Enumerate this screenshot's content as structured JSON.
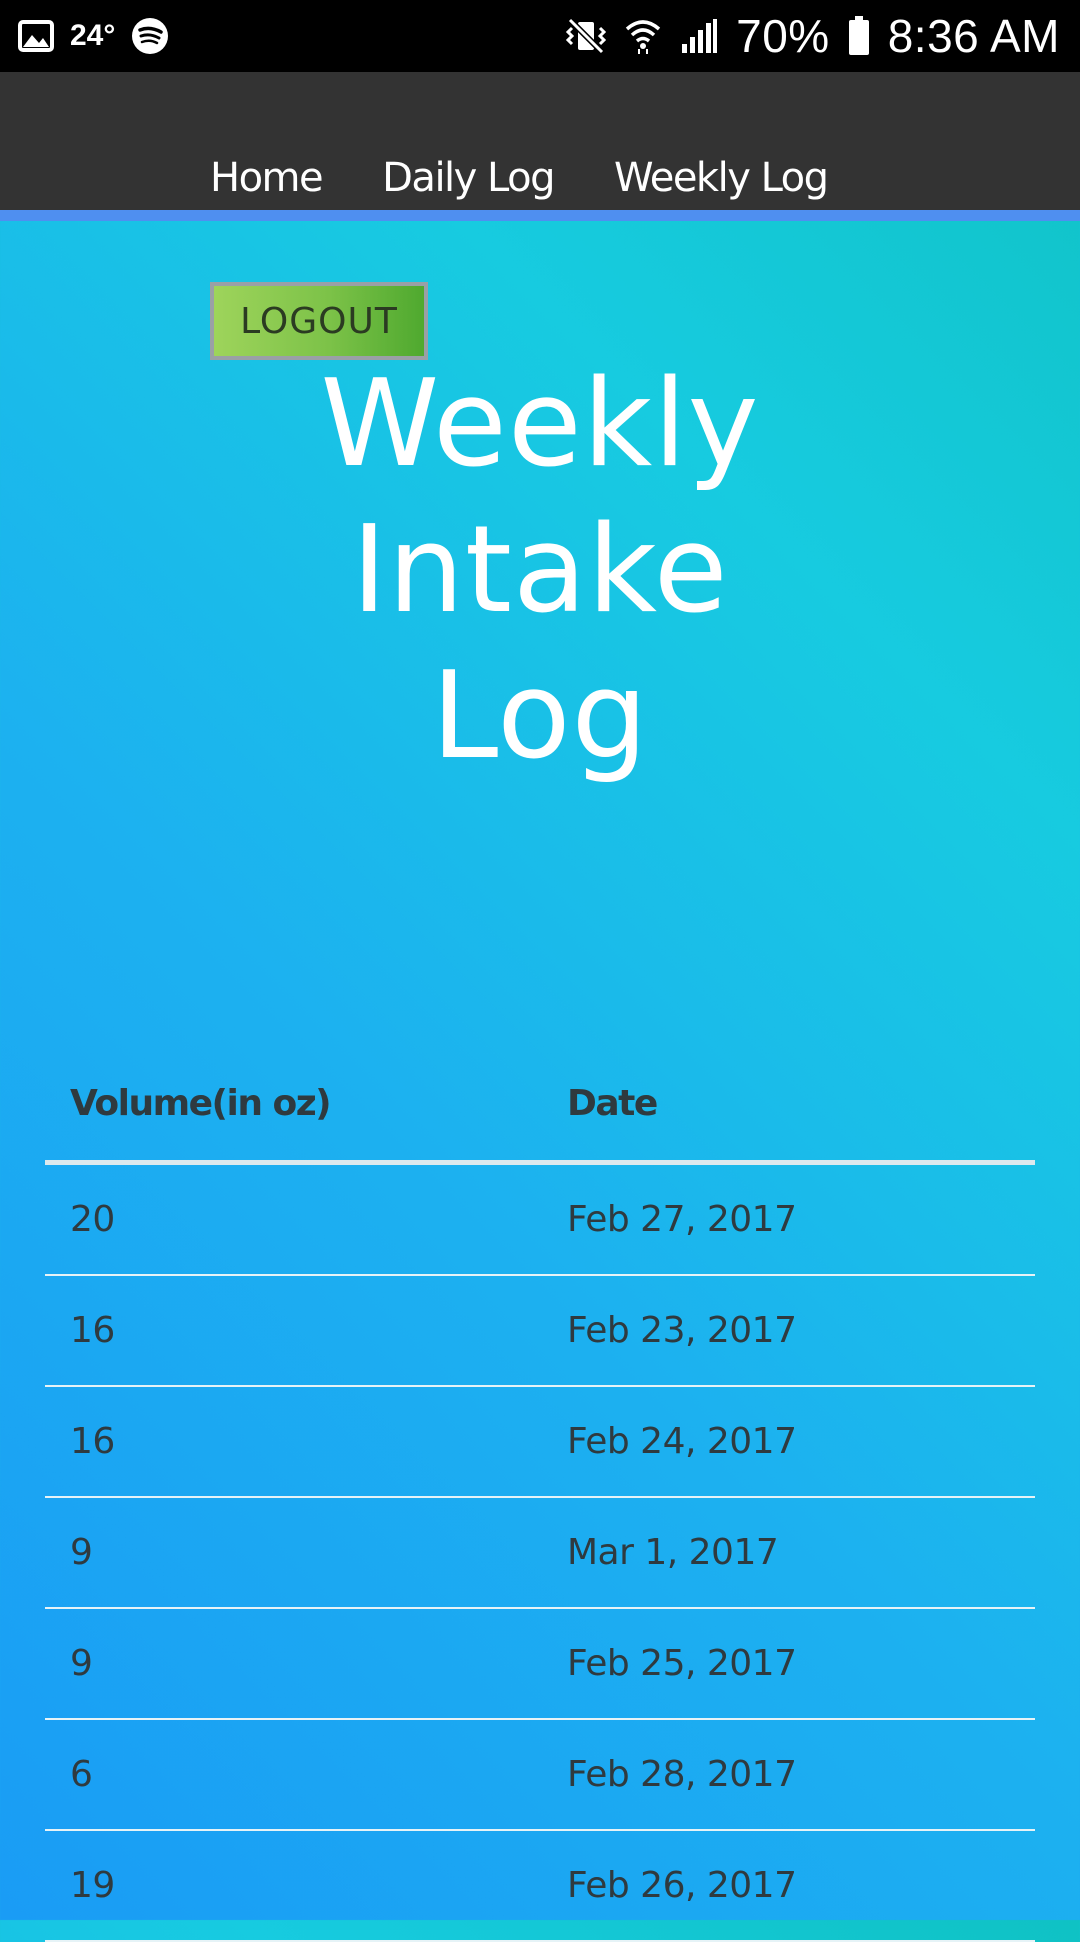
{
  "status_bar": {
    "temperature": "24°",
    "battery": "70%",
    "time": "8:36 AM",
    "left_icons": [
      "image-icon",
      "spotify-icon"
    ],
    "right_icons": [
      "vibrate-icon",
      "wifi-icon",
      "signal-icon",
      "battery-icon"
    ]
  },
  "nav": {
    "items": [
      {
        "label": "Home"
      },
      {
        "label": "Daily Log"
      },
      {
        "label": "Weekly Log"
      }
    ],
    "accent_color": "#4f8ff0"
  },
  "logout_label": "LOGOUT",
  "title_lines": [
    "Weekly",
    "Intake",
    "Log"
  ],
  "table": {
    "headers": [
      "Volume(in oz)",
      "Date"
    ],
    "rows": [
      {
        "volume": "20",
        "date": "Feb 27, 2017"
      },
      {
        "volume": "16",
        "date": "Feb 23, 2017"
      },
      {
        "volume": "16",
        "date": "Feb 24, 2017"
      },
      {
        "volume": "9",
        "date": "Mar 1, 2017"
      },
      {
        "volume": "9",
        "date": "Feb 25, 2017"
      },
      {
        "volume": "6",
        "date": "Feb 28, 2017"
      },
      {
        "volume": "19",
        "date": "Feb 26, 2017"
      }
    ]
  }
}
